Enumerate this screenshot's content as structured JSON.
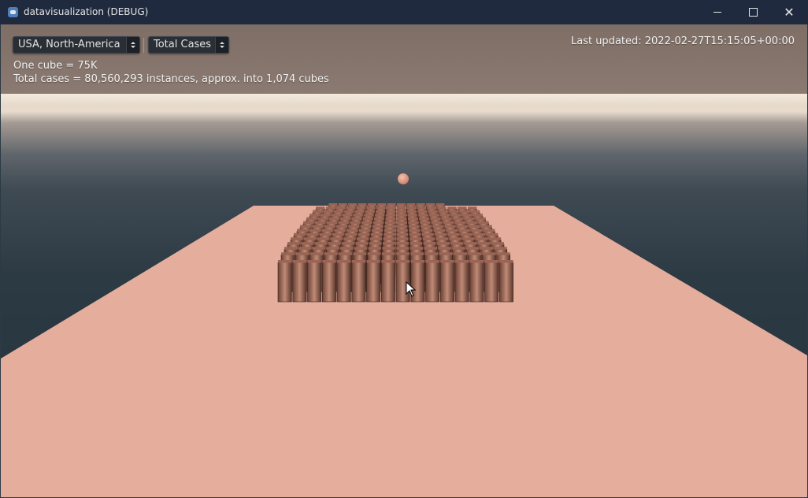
{
  "window": {
    "title": "datavisualization (DEBUG)",
    "icon": "app-gear-icon",
    "controls": [
      "minimize-icon",
      "maximize-icon",
      "close-icon"
    ]
  },
  "hud": {
    "country_select": {
      "value": "USA, North-America"
    },
    "metric_select": {
      "value": "Total Cases"
    },
    "one_cube": "One cube = 75K",
    "total_cases": "Total cases = 80,560,293 instances, approx. into 1,074 cubes",
    "last_updated": "Last updated: 2022-02-27T15:15:05+00:00"
  },
  "scene": {
    "ground_color": "#e5ad9c",
    "cube_color": "#b07a68",
    "sphere_color": "#e49a84",
    "horizon_color": "#efe4d6"
  }
}
